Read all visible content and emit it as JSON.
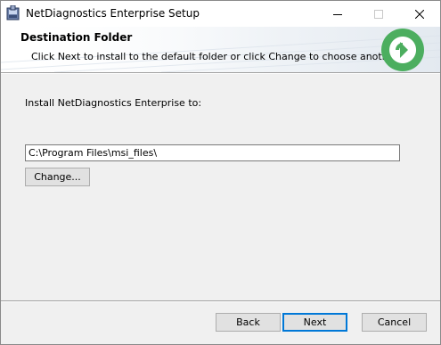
{
  "window": {
    "title": "NetDiagnostics Enterprise Setup",
    "controls": {
      "minimize_icon": "minimize-icon",
      "maximize_icon": "maximize-icon",
      "close_icon": "close-icon"
    }
  },
  "banner": {
    "title": "Destination Folder",
    "subtitle": "Click Next to install to the default folder or click Change to choose another.",
    "logo_icon": "netdiagnostics-logo-icon",
    "logo_color": "#4cae5f"
  },
  "main": {
    "install_label": "Install NetDiagnostics Enterprise to:",
    "install_path": "C:\\Program Files\\msi_files\\",
    "change_button": "Change..."
  },
  "footer": {
    "back_button": "Back",
    "next_button": "Next",
    "cancel_button": "Cancel",
    "default_button_accent": "#0078d7"
  }
}
